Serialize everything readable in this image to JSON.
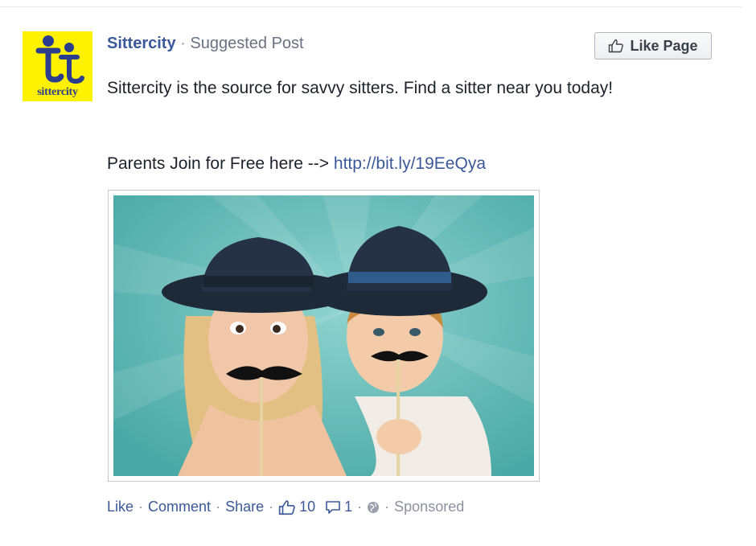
{
  "post": {
    "page_name": "Sittercity",
    "header_separator": "·",
    "post_type": "Suggested Post",
    "like_page_label": "Like Page",
    "avatar_text": "sittercity",
    "body_text": "Sittercity is the source for savvy sitters. Find a sitter near you today!",
    "cta_text": "Parents Join for Free here -->",
    "cta_link": "http://bit.ly/19EeQya"
  },
  "footer": {
    "like_label": "Like",
    "comment_label": "Comment",
    "share_label": "Share",
    "like_count": "10",
    "comment_count": "1",
    "sponsored_label": "Sponsored",
    "separator": "·"
  },
  "icons": {
    "like_page": "thumbs-up-icon",
    "likes": "thumbs-up-icon",
    "comments": "speech-bubble-icon",
    "audience": "globe-icon"
  },
  "colors": {
    "link": "#3b5998",
    "text": "#1d2129",
    "muted": "#8b929e",
    "avatar_bg": "#fff200",
    "avatar_ink": "#2b3d8c",
    "photo_bg": "#5fb6b3"
  }
}
